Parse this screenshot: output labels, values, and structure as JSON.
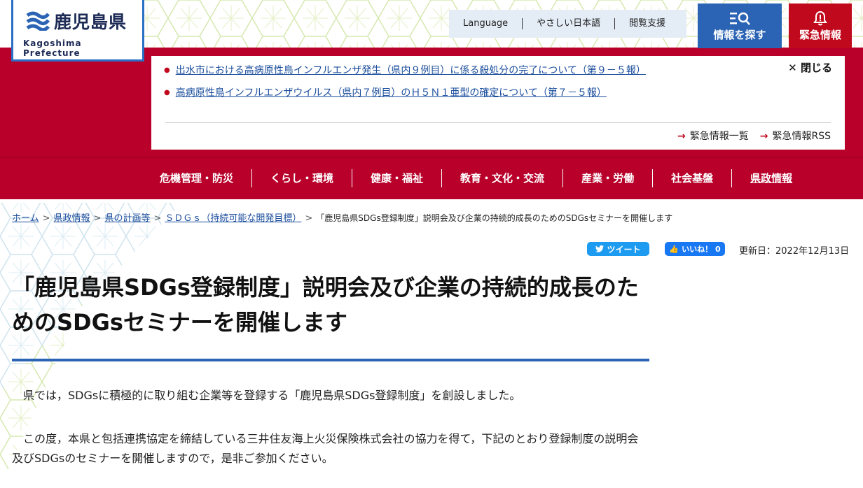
{
  "header": {
    "logo_name": "鹿児島県",
    "logo_en": "Kagoshima Prefecture",
    "util_links": [
      "Language",
      "やさしい日本語",
      "閲覧支援"
    ],
    "search_label": "情報を探す",
    "emergency_label": "緊急情報"
  },
  "alert": {
    "items": [
      "出水市における高病原性鳥インフルエンザ発生（県内９例目）に係る殺処分の完了について（第９－５報）",
      "高病原性鳥インフルエンザウイルス（県内７例目）のＨ５Ｎ１亜型の確定について（第７－５報）"
    ],
    "close_label": "閉じる",
    "links": [
      "緊急情報一覧",
      "緊急情報RSS"
    ]
  },
  "nav": {
    "items": [
      "危機管理・防災",
      "くらし・環境",
      "健康・福祉",
      "教育・文化・交流",
      "産業・労働",
      "社会基盤",
      "県政情報"
    ]
  },
  "breadcrumb": {
    "links": [
      "ホーム",
      "県政情報",
      "県の計画等",
      "ＳＤＧｓ（持続可能な開発目標）"
    ],
    "current": "「鹿児島県SDGs登録制度」説明会及び企業の持続的成長のためのSDGsセミナーを開催します",
    "separator": ">"
  },
  "share": {
    "tweet": "ツイート",
    "like": "いいね！ 0"
  },
  "updated": "更新日：2022年12月13日",
  "article": {
    "title": "「鹿児島県SDGs登録制度」説明会及び企業の持続的成長のためのSDGsセミナーを開催します",
    "para1": "　県では，SDGsに積極的に取り組む企業等を登録する「鹿児島県SDGs登録制度」を創設しました。",
    "para2": "　この度，本県と包括連携協定を締結している三井住友海上火災保険株式会社の協力を得て，下記のとおり登録制度の説明会及びSDGsのセミナーを開催しますので，是非ご参加ください。"
  },
  "colors": {
    "brand_blue": "#2b64b4",
    "emergency_red": "#c0091c",
    "nav_red": "#b8002a",
    "link_blue": "#1a4d9c"
  },
  "icons": [
    "logo-mark-icon",
    "search-list-icon",
    "bell-icon",
    "close-icon",
    "arrow-right-icon",
    "twitter-icon",
    "facebook-like-icon"
  ]
}
